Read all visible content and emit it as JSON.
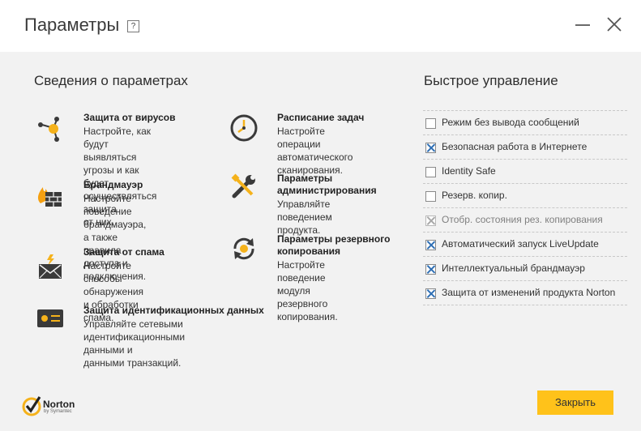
{
  "window": {
    "title": "Параметры",
    "help_label": "?"
  },
  "settings_info": {
    "heading": "Сведения о параметрах",
    "items": [
      {
        "name": "Защита от вирусов",
        "icon": "molecule-icon",
        "desc": [
          "Настройте, как будут",
          "выявляться угрозы и как",
          "будет осуществляться защита",
          "от них."
        ]
      },
      {
        "name": "Брандмауэр",
        "icon": "firewall-icon",
        "desc": [
          "Настройте поведение",
          "брандмауэра, а также",
          "правила доступа и",
          "подключения."
        ]
      },
      {
        "name": "Защита от спама",
        "icon": "spam-envelope-icon",
        "desc": [
          "Настройте способы",
          "обнаружения и обработки",
          "спама."
        ]
      },
      {
        "name": "Защита идентификационных данных",
        "icon": "id-card-icon",
        "desc": [
          "Управляйте сетевыми",
          "идентификационными данными и",
          "данными транзакций."
        ]
      },
      {
        "name": "Расписание задач",
        "icon": "clock-icon",
        "desc": [
          "Настройте операции",
          "автоматического",
          "сканирования."
        ]
      },
      {
        "name": [
          "Параметры",
          "администрирования"
        ],
        "icon": "wrench-icon",
        "desc": [
          "Управляйте поведением",
          "продукта."
        ]
      },
      {
        "name": [
          "Параметры резервного",
          "копирования"
        ],
        "icon": "backup-icon",
        "desc": [
          "Настройте поведение",
          "модуля резервного",
          "копирования."
        ]
      }
    ]
  },
  "quick_control": {
    "heading": "Быстрое управление",
    "items": [
      {
        "label": "Режим без вывода сообщений",
        "checked": false,
        "disabled": false
      },
      {
        "label": "Безопасная работа в Интернете",
        "checked": true,
        "disabled": false
      },
      {
        "label": "Identity Safe",
        "checked": false,
        "disabled": false
      },
      {
        "label": "Резерв. копир.",
        "checked": false,
        "disabled": false
      },
      {
        "label": "Отобр. состояния рез. копирования",
        "checked": true,
        "disabled": true
      },
      {
        "label": "Автоматический запуск LiveUpdate",
        "checked": true,
        "disabled": false
      },
      {
        "label": "Интеллектуальный брандмауэр",
        "checked": true,
        "disabled": false
      },
      {
        "label": "Защита от изменений продукта Norton",
        "checked": true,
        "disabled": false
      }
    ]
  },
  "footer": {
    "logo_name": "Norton",
    "logo_sub": "by Symantec",
    "close_label": "Закрыть"
  },
  "colors": {
    "accent_yellow": "#ffc21a",
    "icon_dark": "#3a3a3a",
    "check_blue": "#2f6fb4"
  }
}
